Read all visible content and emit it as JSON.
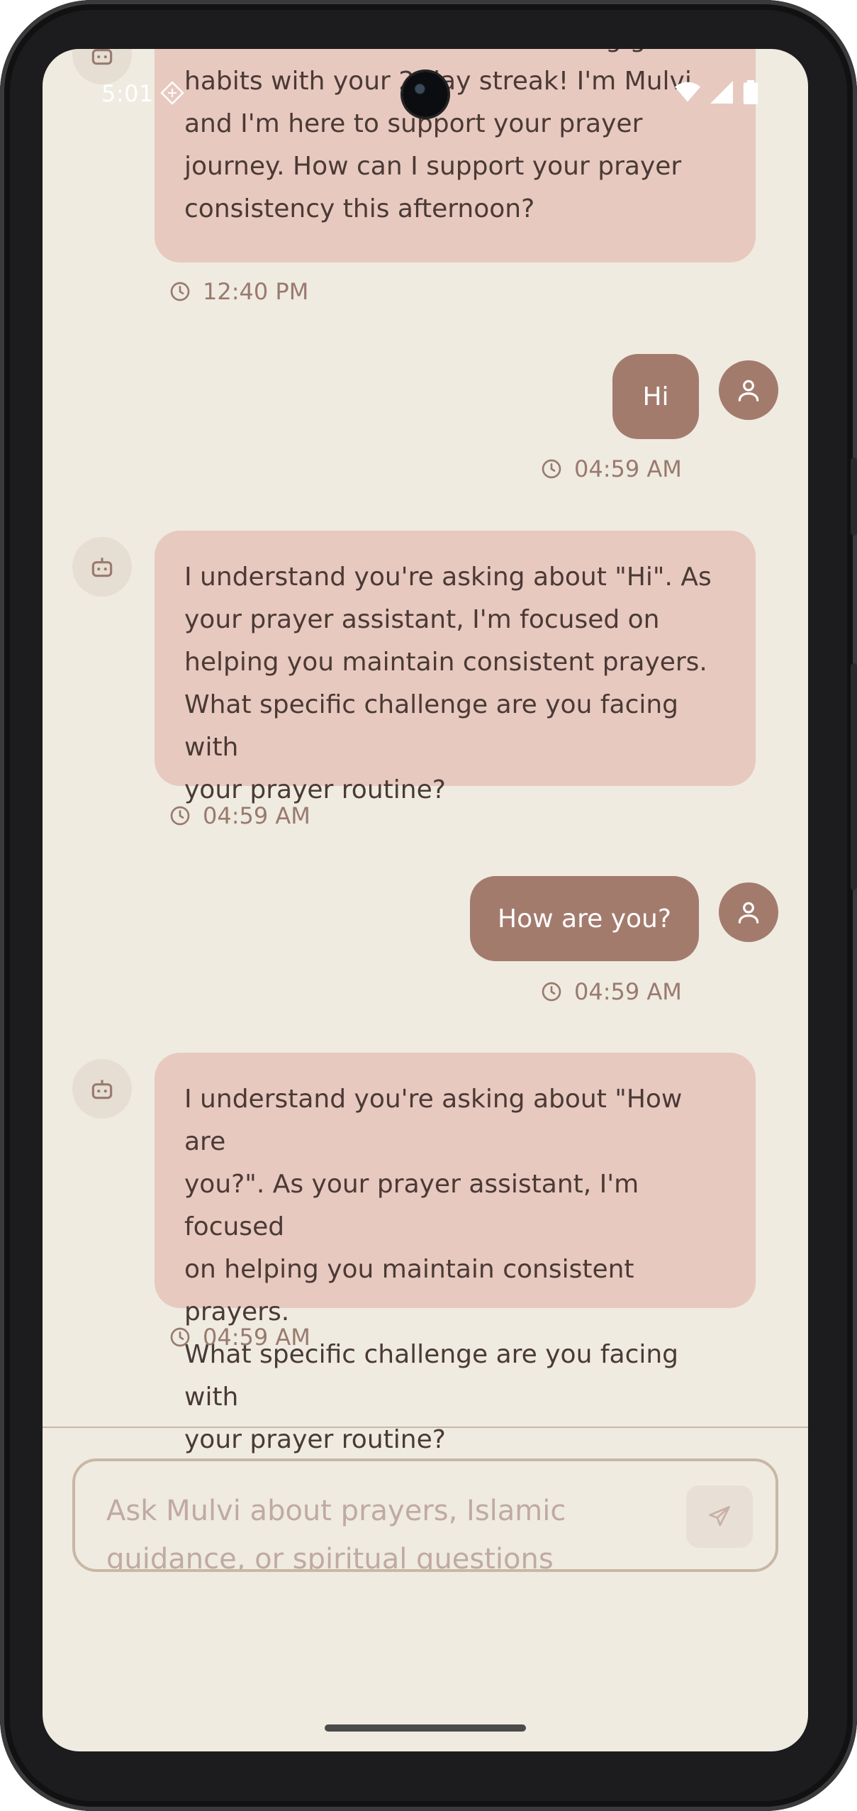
{
  "status_bar": {
    "time": "5:01",
    "icons": [
      "wifi-icon",
      "signal-icon",
      "battery-icon"
    ]
  },
  "colors": {
    "background": "#efebe1",
    "bot_bubble": "#e8c9bf",
    "user_bubble": "#a37b6d",
    "timestamp": "#9a7a6e"
  },
  "messages": [
    {
      "sender": "bot",
      "lines": [
        "Assalamu alaikum! You're building great",
        "habits with your 2-day streak! I'm Mulvi,",
        "and I'm here to support your prayer",
        "journey. How can I support your prayer",
        "consistency this afternoon?"
      ],
      "time": "12:40 PM"
    },
    {
      "sender": "user",
      "text": "Hi",
      "time": "04:59 AM"
    },
    {
      "sender": "bot",
      "lines": [
        "I understand you're asking about \"Hi\". As",
        "your prayer assistant, I'm focused on",
        "helping you maintain consistent prayers.",
        "What specific challenge are you facing with",
        "your prayer routine?"
      ],
      "time": "04:59 AM"
    },
    {
      "sender": "user",
      "text": "How are you?",
      "time": "04:59 AM"
    },
    {
      "sender": "bot",
      "lines": [
        "I understand you're asking about \"How are",
        "you?\". As your prayer assistant, I'm focused",
        "on helping you maintain consistent prayers.",
        "What specific challenge are you facing with",
        "your prayer routine?"
      ],
      "time": "04:59 AM"
    }
  ],
  "composer": {
    "placeholder_lines": [
      "Ask Mulvi about prayers, Islamic",
      "guidance, or spiritual questions"
    ],
    "send_icon": "send-icon"
  }
}
